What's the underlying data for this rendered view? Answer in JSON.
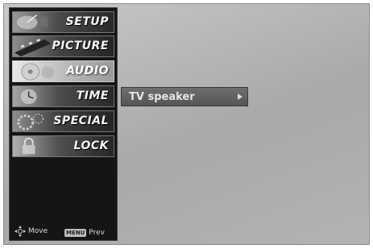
{
  "menu": {
    "items": [
      {
        "label": "SETUP",
        "icon": "satellite-dish-icon",
        "selected": false
      },
      {
        "label": "PICTURE",
        "icon": "film-strip-icon",
        "selected": false
      },
      {
        "label": "AUDIO",
        "icon": "music-cd-icon",
        "selected": true
      },
      {
        "label": "TIME",
        "icon": "clock-icon",
        "selected": false
      },
      {
        "label": "SPECIAL",
        "icon": "gears-icon",
        "selected": false
      },
      {
        "label": "LOCK",
        "icon": "padlock-icon",
        "selected": false
      }
    ]
  },
  "submenu": {
    "label": "TV speaker",
    "arrow_icon": "triangle-right-icon"
  },
  "hints": {
    "move_label": "Move",
    "move_icon": "dpad-icon",
    "prev_key": "MENU",
    "prev_label": "Prev"
  },
  "colors": {
    "sidebar_bg": "#151515",
    "screen_bg": "#b5b5b5",
    "submenu_bg": "#606060",
    "text": "#f5f5f5"
  }
}
